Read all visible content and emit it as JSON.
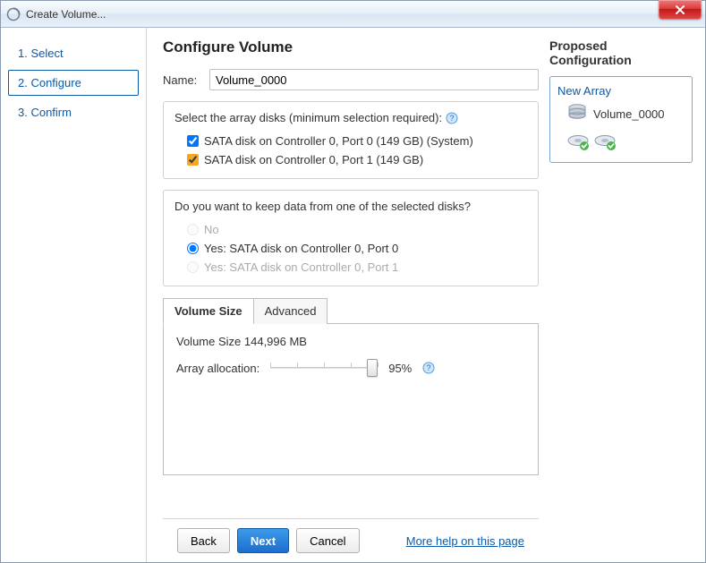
{
  "window": {
    "title": "Create Volume..."
  },
  "sidebar": {
    "steps": [
      {
        "label": "1. Select"
      },
      {
        "label": "2. Configure"
      },
      {
        "label": "3. Confirm"
      }
    ]
  },
  "page": {
    "heading": "Configure Volume",
    "name_label": "Name:",
    "name_value": "Volume_0000",
    "disk_prompt": "Select the array disks (minimum selection required):",
    "disks": [
      {
        "label": "SATA disk on Controller 0, Port 0 (149 GB) (System)",
        "checked": true,
        "system": true
      },
      {
        "label": "SATA disk on Controller 0, Port 1 (149 GB)",
        "checked": true,
        "system": false
      }
    ],
    "keep_data": {
      "prompt": "Do you want to keep data from one of the selected disks?",
      "options": [
        {
          "label": "No",
          "enabled": false,
          "selected": false
        },
        {
          "label": "Yes: SATA disk on Controller 0, Port 0",
          "enabled": true,
          "selected": true
        },
        {
          "label": "Yes: SATA disk on Controller 0, Port 1",
          "enabled": false,
          "selected": false
        }
      ]
    },
    "tabs": [
      {
        "label": "Volume Size",
        "active": true
      },
      {
        "label": "Advanced",
        "active": false
      }
    ],
    "volume_size_line": "Volume Size 144,996 MB",
    "allocation_label": "Array allocation:",
    "allocation_value": "95%"
  },
  "proposed": {
    "heading": "Proposed Configuration",
    "array_label": "New Array",
    "volume_name": "Volume_0000"
  },
  "footer": {
    "back": "Back",
    "next": "Next",
    "cancel": "Cancel",
    "help": "More help on this page"
  }
}
